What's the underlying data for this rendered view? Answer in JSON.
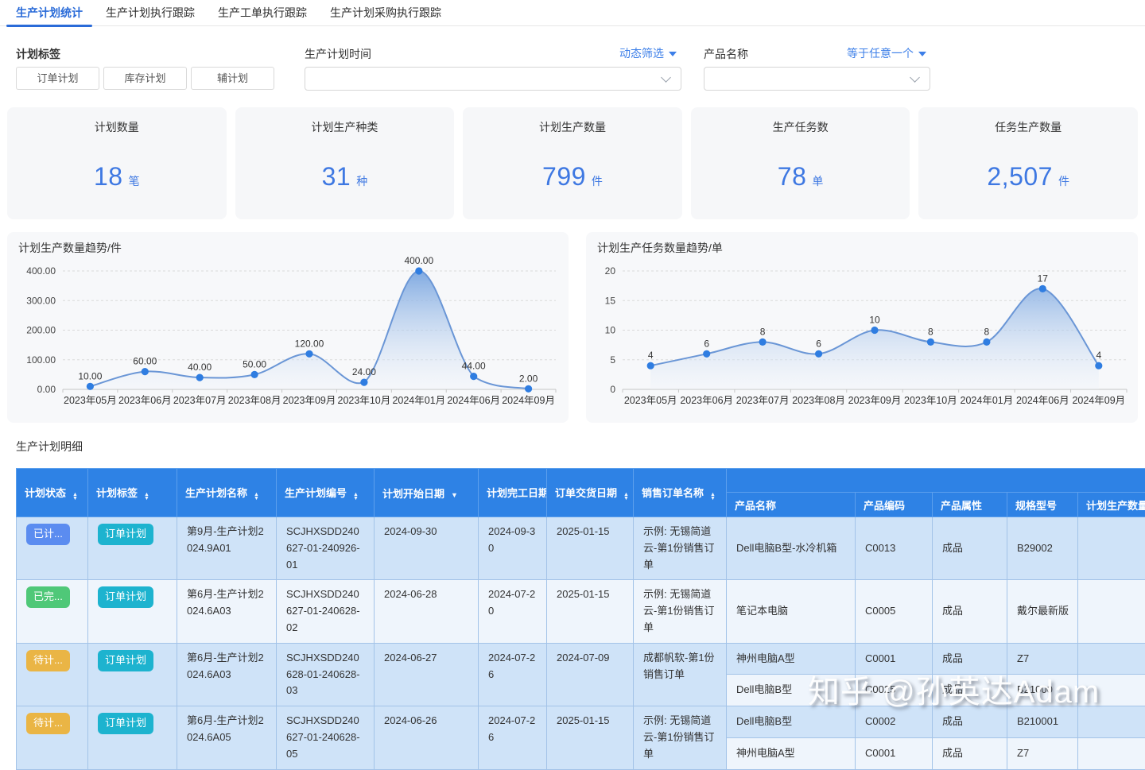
{
  "tabs": [
    {
      "label": "生产计划统计",
      "active": true
    },
    {
      "label": "生产计划执行跟踪",
      "active": false
    },
    {
      "label": "生产工单执行跟踪",
      "active": false
    },
    {
      "label": "生产计划采购执行跟踪",
      "active": false
    }
  ],
  "filters": {
    "plan_tag_label": "计划标签",
    "plan_tag_buttons": [
      "订单计划",
      "库存计划",
      "辅计划"
    ],
    "plan_time_label": "生产计划时间",
    "plan_time_filter": "动态筛选",
    "plan_time_value": "",
    "product_label": "产品名称",
    "product_filter": "等于任意一个",
    "product_value": ""
  },
  "stat_cards": [
    {
      "title": "计划数量",
      "value": "18",
      "unit": "笔"
    },
    {
      "title": "计划生产种类",
      "value": "31",
      "unit": "种"
    },
    {
      "title": "计划生产数量",
      "value": "799",
      "unit": "件"
    },
    {
      "title": "生产任务数",
      "value": "78",
      "unit": "单"
    },
    {
      "title": "任务生产数量",
      "value": "2,507",
      "unit": "件"
    }
  ],
  "chart_data": [
    {
      "type": "area",
      "title": "计划生产数量趋势/件",
      "categories": [
        "2023年05月",
        "2023年06月",
        "2023年07月",
        "2023年08月",
        "2023年09月",
        "2023年10月",
        "2024年01月",
        "2024年06月",
        "2024年09月"
      ],
      "values": [
        10,
        60,
        40,
        50,
        120,
        24,
        400,
        44,
        2
      ],
      "value_labels": [
        "10.00",
        "60.00",
        "40.00",
        "50.00",
        "120.00",
        "24.00",
        "400.00",
        "44.00",
        "2.00"
      ],
      "ylim": [
        0,
        400
      ],
      "yticks": [
        0,
        100,
        200,
        300,
        400
      ],
      "ytick_labels": [
        "0.00",
        "100.00",
        "200.00",
        "300.00",
        "400.00"
      ],
      "grid": "dashed-horizontal",
      "legend": "none"
    },
    {
      "type": "area",
      "title": "计划生产任务数量趋势/单",
      "categories": [
        "2023年05月",
        "2023年06月",
        "2023年07月",
        "2023年08月",
        "2023年09月",
        "2023年10月",
        "2024年01月",
        "2024年06月",
        "2024年09月"
      ],
      "values": [
        4,
        6,
        8,
        6,
        10,
        8,
        8,
        17,
        4
      ],
      "value_labels": [
        "4",
        "6",
        "8",
        "6",
        "10",
        "8",
        "8",
        "17",
        "4"
      ],
      "ylim": [
        0,
        20
      ],
      "yticks": [
        0,
        5,
        10,
        15,
        20
      ],
      "ytick_labels": [
        "0",
        "5",
        "10",
        "15",
        "20"
      ],
      "grid": "dashed-horizontal",
      "legend": "none"
    }
  ],
  "table": {
    "title": "生产计划明细",
    "columns": [
      {
        "label": "计划状态",
        "sort": "both"
      },
      {
        "label": "计划标签",
        "sort": "both"
      },
      {
        "label": "生产计划名称",
        "sort": "both"
      },
      {
        "label": "生产计划编号",
        "sort": "both"
      },
      {
        "label": "计划开始日期",
        "sort": "desc"
      },
      {
        "label": "计划完工日期",
        "sort": "both"
      },
      {
        "label": "订单交货日期",
        "sort": "both"
      },
      {
        "label": "销售订单名称",
        "sort": "both"
      },
      {
        "label": "产品名称",
        "sort": "none"
      },
      {
        "label": "产品编码",
        "sort": "none"
      },
      {
        "label": "产品属性",
        "sort": "none"
      },
      {
        "label": "规格型号",
        "sort": "none"
      },
      {
        "label": "计划生产数量",
        "sort": "none"
      }
    ],
    "rows": [
      {
        "status": "已计...",
        "status_color": "status_planned",
        "tag": "订单计划",
        "name": "第9月-生产计划2024.9A01",
        "code": "SCJHXSDD240627-01-240926-01",
        "start_date": "2024-09-30",
        "finish_date": "2024-09-30",
        "delivery_date": "2025-01-15",
        "sales_order": "示例: 无锡简道云-第1份销售订单",
        "products": [
          {
            "name": "Dell电脑B型-水冷机箱",
            "code": "C0013",
            "attr": "成品",
            "spec": "B29002",
            "qty": ""
          }
        ]
      },
      {
        "status": "已完...",
        "status_color": "status_done",
        "tag": "订单计划",
        "name": "第6月-生产计划2024.6A03",
        "code": "SCJHXSDD240627-01-240628-02",
        "start_date": "2024-06-28",
        "finish_date": "2024-07-20",
        "delivery_date": "2025-01-15",
        "sales_order": "示例: 无锡简道云-第1份销售订单",
        "products": [
          {
            "name": "笔记本电脑",
            "code": "C0005",
            "attr": "成品",
            "spec": "戴尔最新版",
            "qty": ""
          }
        ]
      },
      {
        "status": "待计...",
        "status_color": "status_pending",
        "tag": "订单计划",
        "name": "第6月-生产计划2024.6A03",
        "code": "SCJHXSDD240628-01-240628-03",
        "start_date": "2024-06-27",
        "finish_date": "2024-07-26",
        "delivery_date": "2024-07-09",
        "sales_order": "成都帆软-第1份销售订单",
        "products": [
          {
            "name": "神州电脑A型",
            "code": "C0001",
            "attr": "成品",
            "spec": "Z7",
            "qty": ""
          },
          {
            "name": "Dell电脑B型",
            "code": "C0025",
            "attr": "成品",
            "spec": "B21000",
            "qty": ""
          }
        ]
      },
      {
        "status": "待计...",
        "status_color": "status_pending",
        "tag": "订单计划",
        "name": "第6月-生产计划2024.6A05",
        "code": "SCJHXSDD240627-01-240628-05",
        "start_date": "2024-06-26",
        "finish_date": "2024-07-26",
        "delivery_date": "2025-01-15",
        "sales_order": "示例: 无锡简道云-第1份销售订单",
        "products": [
          {
            "name": "Dell电脑B型",
            "code": "C0002",
            "attr": "成品",
            "spec": "B210001",
            "qty": ""
          },
          {
            "name": "神州电脑A型",
            "code": "C0001",
            "attr": "成品",
            "spec": "Z7",
            "qty": ""
          }
        ]
      }
    ]
  },
  "watermark": "知乎 @孙英达Adam",
  "colors": {
    "accent": "#2a6bd8",
    "link": "#3d7fe8",
    "stat_value": "#3e78e2",
    "table_header_bg": "#2e82e5",
    "row_blue": "#cfe3f8",
    "row_light": "#eff5fc",
    "status_planned": "#5b8cf0",
    "status_done": "#4fc878",
    "status_pending": "#eab545",
    "tag": "#1db3cf",
    "chart_line": "#6a96d6",
    "chart_dot": "#2f7de1"
  }
}
